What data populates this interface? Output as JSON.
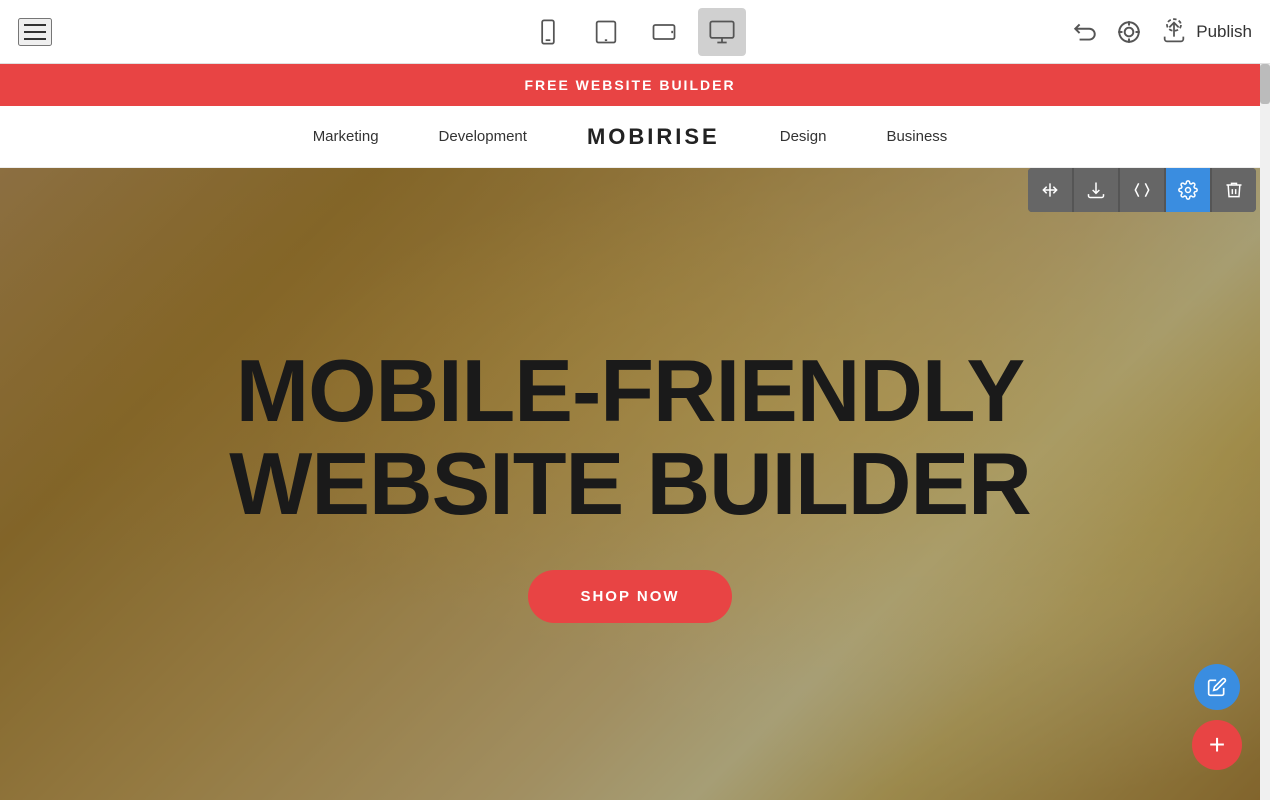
{
  "toolbar": {
    "publish_label": "Publish"
  },
  "devices": [
    {
      "id": "mobile",
      "label": "Mobile view"
    },
    {
      "id": "tablet",
      "label": "Tablet view"
    },
    {
      "id": "tablet-landscape",
      "label": "Tablet landscape view"
    },
    {
      "id": "desktop",
      "label": "Desktop view"
    }
  ],
  "promo_banner": {
    "text": "FREE WEBSITE BUILDER"
  },
  "nav": {
    "logo": "MOBIRISE",
    "links": [
      "Marketing",
      "Development",
      "Design",
      "Business"
    ]
  },
  "hero": {
    "title_line1": "MOBILE-FRIENDLY",
    "title_line2": "WEBSITE BUILDER",
    "cta_button": "SHOP NOW"
  },
  "section_tools": [
    {
      "id": "move",
      "label": "Move section"
    },
    {
      "id": "download",
      "label": "Download section"
    },
    {
      "id": "code",
      "label": "Edit code"
    },
    {
      "id": "settings",
      "label": "Section settings"
    },
    {
      "id": "delete",
      "label": "Delete section"
    }
  ],
  "fab": {
    "edit_label": "Edit",
    "add_label": "Add"
  }
}
